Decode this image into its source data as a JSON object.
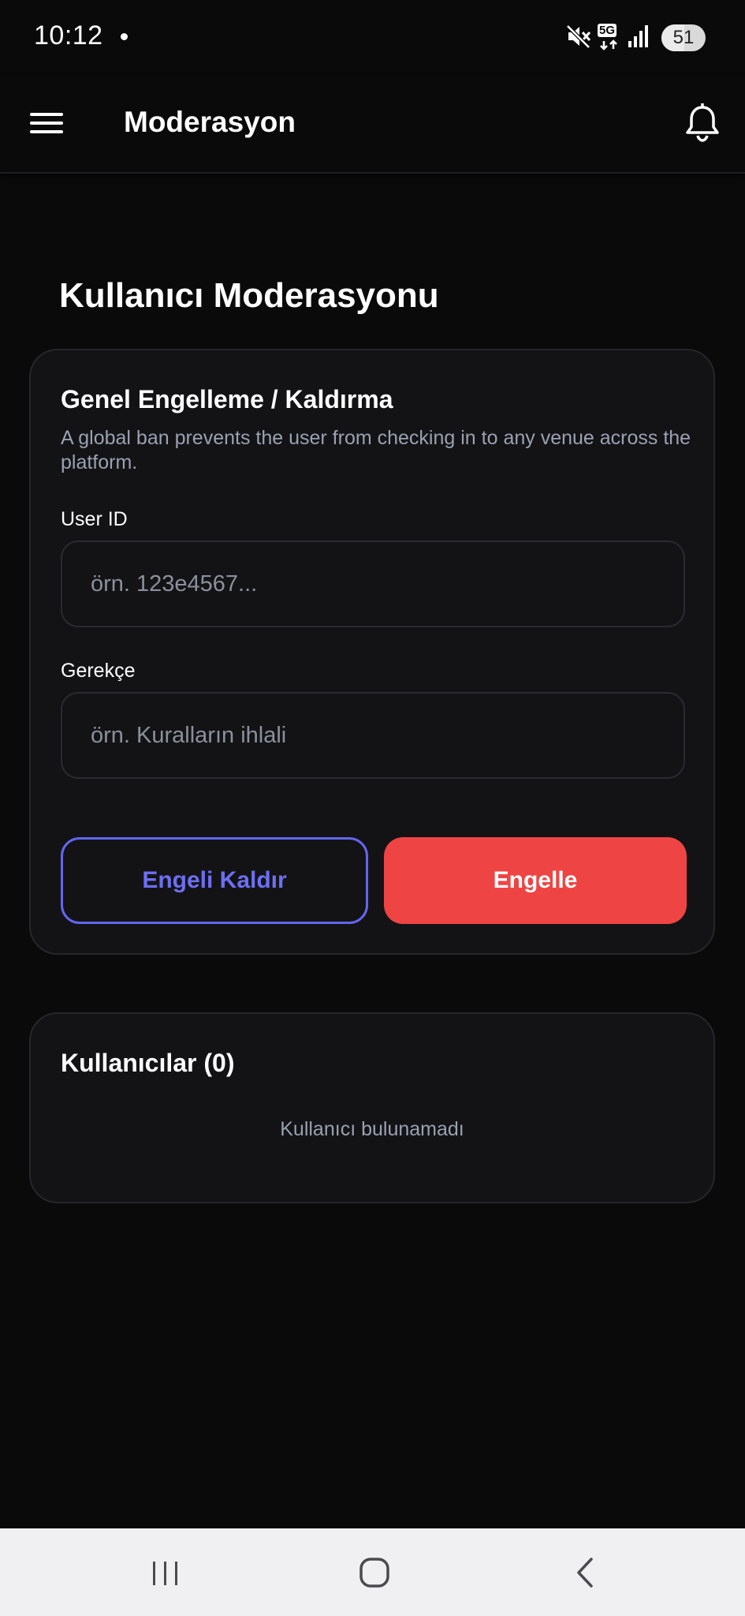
{
  "status_bar": {
    "time": "10:12",
    "network": "5G",
    "battery": "51",
    "battery_level": 0.51
  },
  "app_bar": {
    "title": "Moderasyon",
    "menu_icon": "hamburger-menu-icon",
    "notification_icon": "bell-icon"
  },
  "page": {
    "title": "Kullanıcı Moderasyonu"
  },
  "ban_card": {
    "title": "Genel Engelleme / Kaldırma",
    "description": "A global ban prevents the user from checking in to any venue across the platform.",
    "user_id": {
      "label": "User ID",
      "value": "",
      "placeholder": "örn. 123e4567..."
    },
    "reason": {
      "label": "Gerekçe",
      "value": "",
      "placeholder": "örn. Kuralların ihlali"
    },
    "unban_label": "Engeli Kaldır",
    "ban_label": "Engelle"
  },
  "users_card": {
    "title": "Kullanıcılar (0)",
    "empty_text": "Kullanıcı bulunamadı"
  },
  "colors": {
    "background": "#0a0a0b",
    "card": "#131316",
    "accent": "#6366f1",
    "danger": "#ef4444",
    "muted_text": "#9aa1b1"
  },
  "nav_bar": {
    "recents_icon": "recents-icon",
    "home_icon": "home-icon",
    "back_icon": "back-icon"
  }
}
